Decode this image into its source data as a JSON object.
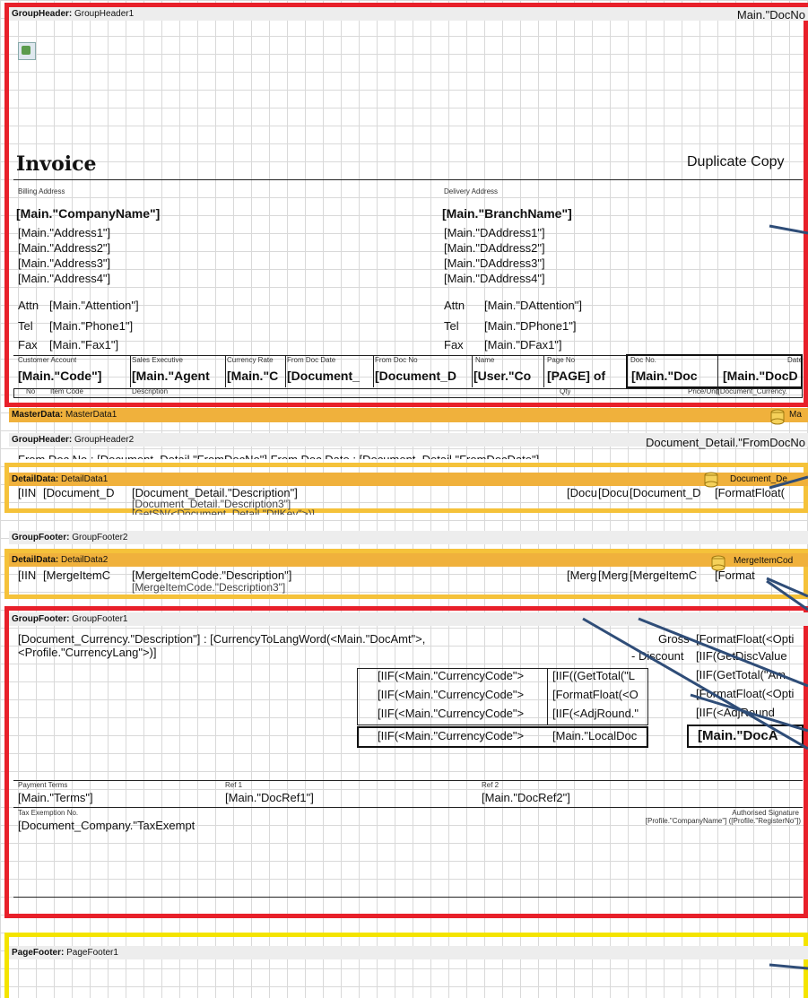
{
  "bands": {
    "groupheader1": {
      "kind": "GroupHeader:",
      "name": "GroupHeader1",
      "right_text": "Main.\"DocNo"
    },
    "masterdata1": {
      "kind": "MasterData:",
      "name": "MasterData1",
      "right_text": "Ma"
    },
    "groupheader2": {
      "kind": "GroupHeader:",
      "name": "GroupHeader2",
      "right_text": "Document_Detail.\"FromDocNo",
      "sub_text": "From Doc No : [Document_Detail.\"FromDocNo\"] From Doc Date : [Document_Detail.\"FromDocDate\"]"
    },
    "detaildata1": {
      "kind": "DetailData:",
      "name": "DetailData1",
      "right_text": "Document_De"
    },
    "groupfooter2": {
      "kind": "GroupFooter:",
      "name": "GroupFooter2"
    },
    "detaildata2": {
      "kind": "DetailData:",
      "name": "DetailData2",
      "right_text": "MergeItemCod"
    },
    "groupfooter1": {
      "kind": "GroupFooter:",
      "name": "GroupFooter1"
    },
    "pagefooter1": {
      "kind": "PageFooter:",
      "name": "PageFooter1"
    }
  },
  "header": {
    "title": "Invoice",
    "duplicate": "Duplicate Copy",
    "billing_label": "Billing Address",
    "delivery_label": "Delivery Address",
    "company": "[Main.\"CompanyName\"]",
    "branch": "[Main.\"BranchName\"]",
    "address": [
      "[Main.\"Address1\"]",
      "[Main.\"Address2\"]",
      "[Main.\"Address3\"]",
      "[Main.\"Address4\"]"
    ],
    "daddress": [
      "[Main.\"DAddress1\"]",
      "[Main.\"DAddress2\"]",
      "[Main.\"DAddress3\"]",
      "[Main.\"DAddress4\"]"
    ],
    "attn_label": "Attn",
    "tel_label": "Tel",
    "fax_label": "Fax",
    "attn": "[Main.\"Attention\"]",
    "tel": "[Main.\"Phone1\"]",
    "fax": "[Main.\"Fax1\"]",
    "dattn": "[Main.\"DAttention\"]",
    "dtel": "[Main.\"DPhone1\"]",
    "dfax": "[Main.\"DFax1\"]"
  },
  "info_row": {
    "labels": [
      "Customer Account",
      "Sales Executive",
      "Currency Rate",
      "From Doc Date",
      "From Doc No",
      "Name",
      "Page No",
      "Doc No.",
      "Date"
    ],
    "values": [
      "[Main.\"Code\"]",
      "[Main.\"Agent",
      "[Main.\"C",
      "[Document_",
      "[Document_D",
      "[User.\"Co",
      "[PAGE] of",
      "[Main.\"Doc",
      "[Main.\"DocD"
    ]
  },
  "columns": {
    "no": "No",
    "item_code": "Item Code",
    "description": "Description",
    "qty": "Qty",
    "price": "Price/Unit",
    "currency": "([Document_Currency."
  },
  "detail1": {
    "c1": "[IIN",
    "c2": "[Document_D",
    "desc": "[Document_Detail.\"Description\"]",
    "desc3": "[Document_Detail.\"Description3\"]",
    "sn": "[GetSN(<Document_Detail.\"DtlKey\">)]",
    "c4": "[Docu",
    "c5": "[Docu",
    "c6": "[Document_D",
    "c7": "[FormatFloat("
  },
  "detail2": {
    "c1": "[IIN",
    "c2": "[MergeItemC",
    "desc": "[MergeItemCode.\"Description\"]",
    "desc3": "[MergeItemCode.\"Description3\"]",
    "c4": "[Merg",
    "c5": "[Merg",
    "c6": "[MergeItemC",
    "c7": "[Format"
  },
  "footer1": {
    "amount_words_1": "[Document_Currency.\"Description\"] : [CurrencyToLangWord(<Main.\"DocAmt\">,",
    "amount_words_2": "<Profile.\"CurrencyLang\">)]",
    "gross_label": "Gross",
    "gross_val": "[FormatFloat(<Opti",
    "disc_label": "- Discount",
    "disc_val": "[IIF(GetDiscValue",
    "r3_val": "[IIF(GetTotal(\"Am",
    "r4_val": "[FormatFloat(<Opti",
    "r5_val": "[IIF(<AdjRound",
    "total_val": "[Main.\"DocA",
    "mid_left": [
      "[IIF(<Main.\"CurrencyCode\">",
      "[IIF(<Main.\"CurrencyCode\">",
      "[IIF(<Main.\"CurrencyCode\">",
      "[IIF(<Main.\"CurrencyCode\">"
    ],
    "mid_right": [
      "[IIF((GetTotal(\"L",
      "[FormatFloat(<O",
      "[IIF(<AdjRound.\"",
      "[Main.\"LocalDoc"
    ],
    "terms_label": "Payment Terms",
    "terms": "[Main.\"Terms\"]",
    "ref1_label": "Ref 1",
    "ref1": "[Main.\"DocRef1\"]",
    "ref2_label": "Ref 2",
    "ref2": "[Main.\"DocRef2\"]",
    "tax_label": "Tax Exemption No.",
    "tax": "[Document_Company.\"TaxExempt",
    "sig_label": "Authorised Signature",
    "sig_text": "[Profile.\"CompanyName\"] ([Profile.\"RegisterNo\"])"
  },
  "colors": {
    "red": "#e8202a",
    "yellow": "#f4e400",
    "orange": "#f0b13c",
    "gray": "#ededed"
  }
}
